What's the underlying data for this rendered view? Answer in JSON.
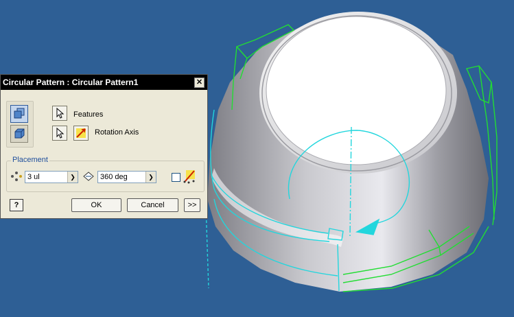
{
  "dialog": {
    "title": "Circular Pattern : Circular Pattern1",
    "close_glyph": "✕",
    "features_label": "Features",
    "rotation_axis_label": "Rotation Axis",
    "placement_title": "Placement",
    "count_value": "3 ul",
    "angle_value": "360 deg",
    "ok_label": "OK",
    "cancel_label": "Cancel",
    "more_label": ">>",
    "help_glyph": "?"
  },
  "icons": {
    "mode_features": "pattern-features-icon",
    "mode_solid": "pattern-solid-icon",
    "select_features": "cursor-arrow-icon",
    "select_axis": "cursor-arrow-icon",
    "axis_flip": "flip-axis-icon",
    "count": "occurrence-count-icon",
    "angle": "angle-icon",
    "midplane": "midplane-icon"
  },
  "colors": {
    "viewport_background": "#2e5f95",
    "dialog_background": "#ece9d8",
    "titlebar": "#000000",
    "highlight_edges": "#22dd33",
    "axis_and_arc": "#22d6dd",
    "part_surface": "#a8a8ae",
    "placement_title": "#1f4f9c"
  }
}
